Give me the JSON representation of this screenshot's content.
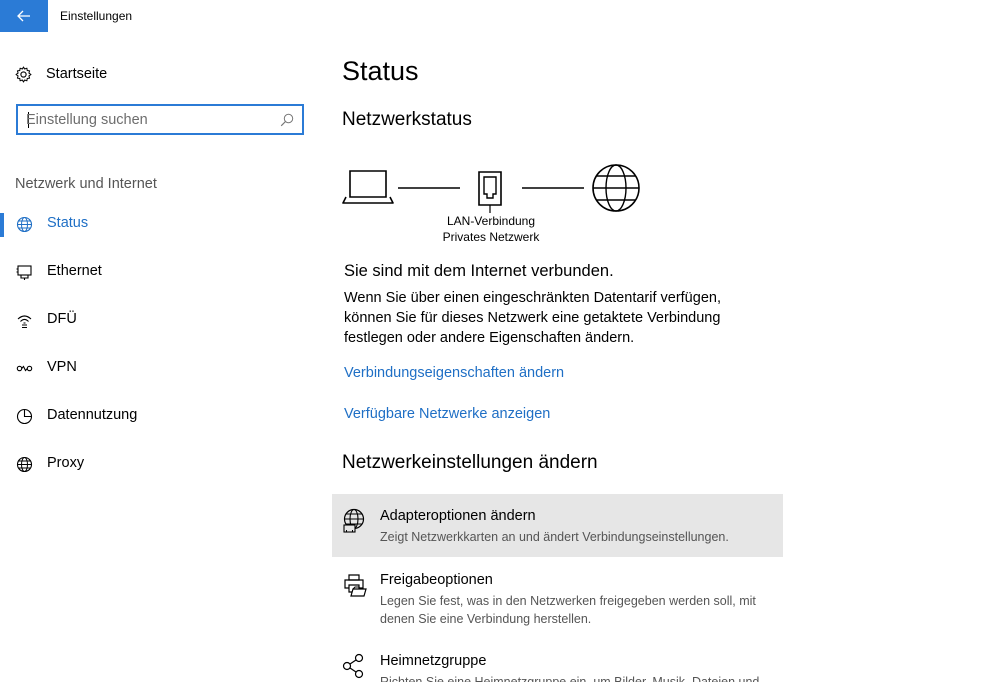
{
  "window": {
    "title": "Einstellungen"
  },
  "sidebar": {
    "home_label": "Startseite",
    "search_placeholder": "Einstellung suchen",
    "section_label": "Netzwerk und Internet",
    "items": [
      {
        "label": "Status",
        "icon": "globe-status-icon",
        "active": true
      },
      {
        "label": "Ethernet",
        "icon": "ethernet-icon",
        "active": false
      },
      {
        "label": "DFÜ",
        "icon": "dialup-icon",
        "active": false
      },
      {
        "label": "VPN",
        "icon": "vpn-icon",
        "active": false
      },
      {
        "label": "Datennutzung",
        "icon": "data-usage-icon",
        "active": false
      },
      {
        "label": "Proxy",
        "icon": "globe-icon",
        "active": false
      }
    ]
  },
  "main": {
    "title": "Status",
    "network_status_heading": "Netzwerkstatus",
    "diagram": {
      "connection_name": "LAN-Verbindung",
      "network_type": "Privates Netzwerk"
    },
    "connected_text": "Sie sind mit dem Internet verbunden.",
    "description": "Wenn Sie über einen eingeschränkten Datentarif verfügen, können Sie für dieses Netzwerk eine getaktete Verbindung festlegen oder andere Eigenschaften ändern.",
    "links": {
      "change_properties": "Verbindungseigenschaften ändern",
      "show_networks": "Verfügbare Netzwerke anzeigen"
    },
    "change_settings_heading": "Netzwerkeinstellungen ändern",
    "options": [
      {
        "title": "Adapteroptionen ändern",
        "desc": "Zeigt Netzwerkkarten an und ändert Verbindungseinstellungen."
      },
      {
        "title": "Freigabeoptionen",
        "desc": "Legen Sie fest, was in den Netzwerken freigegeben werden soll, mit denen Sie eine Verbindung herstellen."
      },
      {
        "title": "Heimnetzgruppe",
        "desc": "Richten Sie eine Heimnetzgruppe ein, um Bilder, Musik, Dateien und"
      }
    ]
  },
  "colors": {
    "accent": "#2b7bd6",
    "link": "#1f6fc5",
    "hover_bg": "#e6e6e6"
  }
}
